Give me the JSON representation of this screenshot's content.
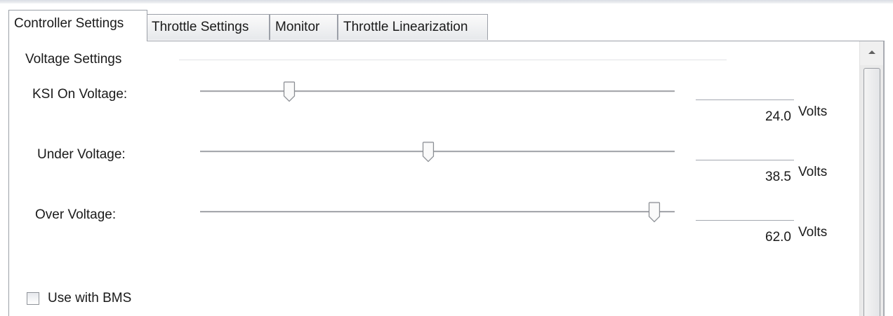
{
  "tabs": [
    {
      "label": "Controller Settings",
      "active": true
    },
    {
      "label": "Throttle Settings",
      "active": false
    },
    {
      "label": "Monitor",
      "active": false
    },
    {
      "label": "Throttle Linearization",
      "active": false
    }
  ],
  "group": {
    "title": "Voltage Settings"
  },
  "sliders": [
    {
      "label": "KSI On Voltage:",
      "value": "24.0",
      "unit": "Volts",
      "position": 0.18
    },
    {
      "label": "Under Voltage:",
      "value": "38.5",
      "unit": "Volts",
      "position": 0.48
    },
    {
      "label": "Over Voltage:",
      "value": "62.0",
      "unit": "Volts",
      "position": 0.97
    }
  ],
  "options": {
    "use_with_bms_label": "Use with BMS",
    "use_with_bms_checked": false
  },
  "colors": {
    "tab_border": "#9ca0a8",
    "slider_track": "#a6a8ad"
  }
}
